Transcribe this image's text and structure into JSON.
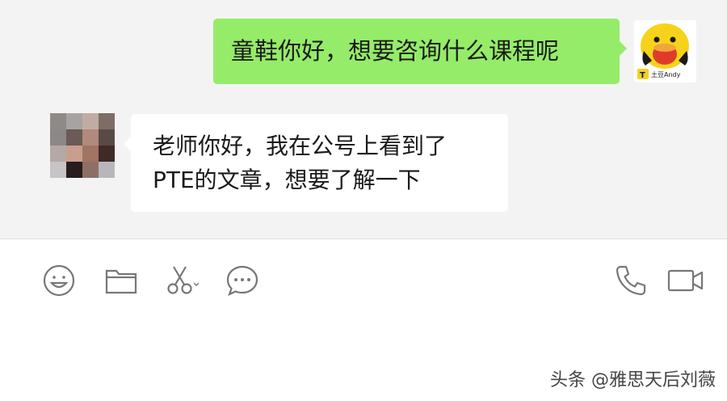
{
  "messages": {
    "outgoing": {
      "text": "童鞋你好，想要咨询什么课程呢",
      "avatar_label": "土豆Andy"
    },
    "incoming": {
      "line1": "老师你好，我在公号上看到了",
      "line2": "PTE的文章，想要了解一下"
    }
  },
  "toolbar": {
    "icons": [
      "emoji-icon",
      "folder-icon",
      "scissors-icon",
      "chat-bubble-icon",
      "phone-icon",
      "video-call-icon"
    ]
  },
  "watermark": "头条 @雅思天后刘薇",
  "colors": {
    "chat_background": "#f3f3f3",
    "outgoing_bubble": "#95ec69",
    "incoming_bubble": "#ffffff",
    "icon_stroke": "#777777"
  }
}
